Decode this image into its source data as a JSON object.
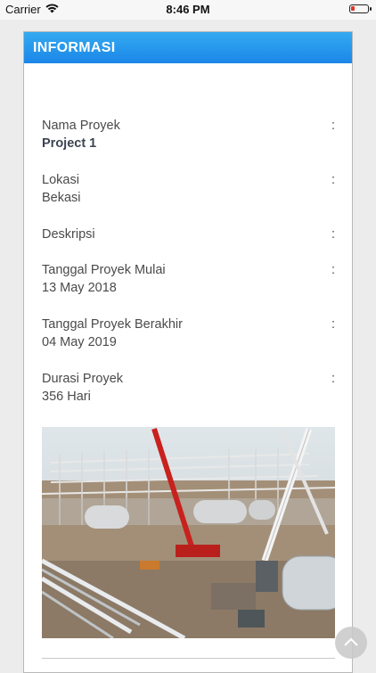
{
  "status": {
    "carrier": "Carrier",
    "time": "8:46 PM"
  },
  "header": {
    "title": "INFORMASI"
  },
  "fields": [
    {
      "label": "Nama Proyek",
      "value": "Project 1"
    },
    {
      "label": "Lokasi",
      "value": "Bekasi"
    },
    {
      "label": "Deskripsi",
      "value": ""
    },
    {
      "label": "Tanggal Proyek Mulai",
      "value": "13 May 2018"
    },
    {
      "label": "Tanggal Proyek Berakhir",
      "value": "04 May 2019"
    },
    {
      "label": "Durasi Proyek",
      "value": "356 Hari"
    }
  ],
  "colon": ":",
  "icons": {
    "wifi": "wifi-icon",
    "battery": "battery-icon",
    "scroll_top": "chevron-up-icon"
  },
  "colors": {
    "header_top": "#34aaf0",
    "header_bottom": "#1b86e8",
    "battery_low": "#e0342a"
  }
}
